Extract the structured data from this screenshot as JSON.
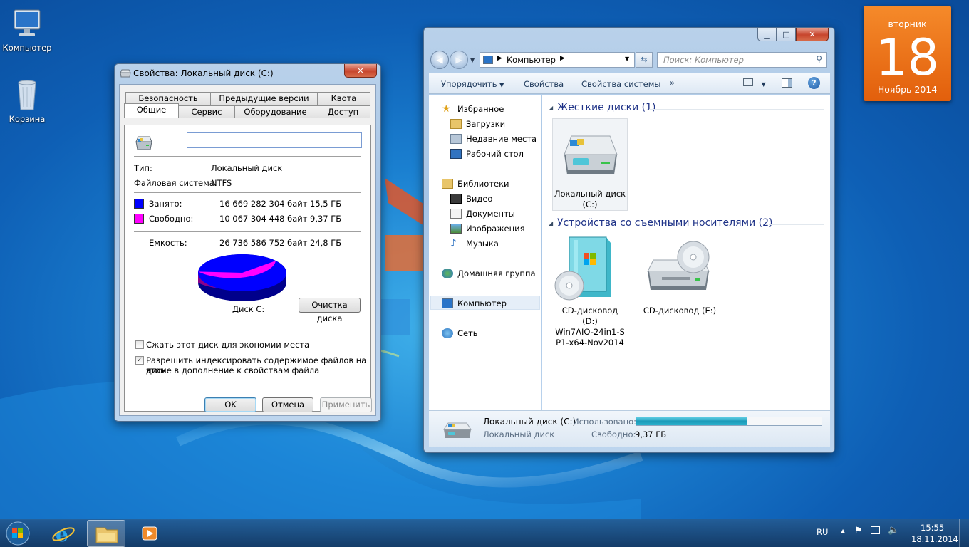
{
  "desktop": {
    "icons": [
      {
        "label": "Компьютер"
      },
      {
        "label": "Корзина"
      }
    ]
  },
  "gadget": {
    "weekday": "вторник",
    "day": "18",
    "month_year": "Ноябрь 2014"
  },
  "dialog": {
    "title": "Свойства: Локальный диск (C:)",
    "tabs_row1": [
      "Безопасность",
      "Предыдущие версии",
      "Квота"
    ],
    "tabs_row2": [
      "Общие",
      "Сервис",
      "Оборудование",
      "Доступ"
    ],
    "active_tab": "Общие",
    "name_value": "",
    "type_label": "Тип:",
    "type_value": "Локальный диск",
    "fs_label": "Файловая система:",
    "fs_value": "NTFS",
    "used_label": "Занято:",
    "used_bytes": "16 669 282 304 байт",
    "used_gb": "15,5 ГБ",
    "free_label": "Свободно:",
    "free_bytes": "10 067 304 448 байт",
    "free_gb": "9,37 ГБ",
    "capacity_label": "Емкость:",
    "capacity_bytes": "26 736 586 752 байт",
    "capacity_gb": "24,8 ГБ",
    "disk_label": "Диск C:",
    "cleanup_button": "Очистка диска",
    "compress_label": "Сжать этот диск для экономии места",
    "compress_checked": false,
    "index_label_1": "Разрешить индексировать содержимое файлов на этом",
    "index_label_2": "диске в дополнение к свойствам файла",
    "index_checked": true,
    "ok": "OK",
    "cancel": "Отмена",
    "apply": "Применить",
    "used_color": "#0000ff",
    "free_color": "#ff00ff",
    "used_fraction": 0.623
  },
  "explorer": {
    "address": "Компьютер",
    "search_placeholder": "Поиск: Компьютер",
    "toolbar": [
      "Упорядочить",
      "Свойства",
      "Свойства системы",
      "»"
    ],
    "nav": {
      "favorites": "Избранное",
      "fav_items": [
        "Загрузки",
        "Недавние места",
        "Рабочий стол"
      ],
      "libraries": "Библиотеки",
      "lib_items": [
        "Видео",
        "Документы",
        "Изображения",
        "Музыка"
      ],
      "homegroup": "Домашняя группа",
      "computer": "Компьютер",
      "network": "Сеть"
    },
    "hard_disks_title": "Жесткие диски (1)",
    "local_disk_label_1": "Локальный диск",
    "local_disk_label_2": "(C:)",
    "removable_title": "Устройства со съемными носителями (2)",
    "cd_d_lines": [
      "CD-дисковод",
      "(D:)",
      "Win7AIO-24in1-S",
      "P1-x64-Nov2014"
    ],
    "cd_e_label": "CD-дисковод (E:)",
    "details": {
      "name": "Локальный диск (C:)",
      "type": "Локальный диск",
      "used_label": "Использовано:",
      "free_label": "Свободно:",
      "free_value": "9,37 ГБ",
      "used_fraction": 0.6
    }
  },
  "taskbar": {
    "lang": "RU",
    "time": "15:55",
    "date": "18.11.2014"
  }
}
